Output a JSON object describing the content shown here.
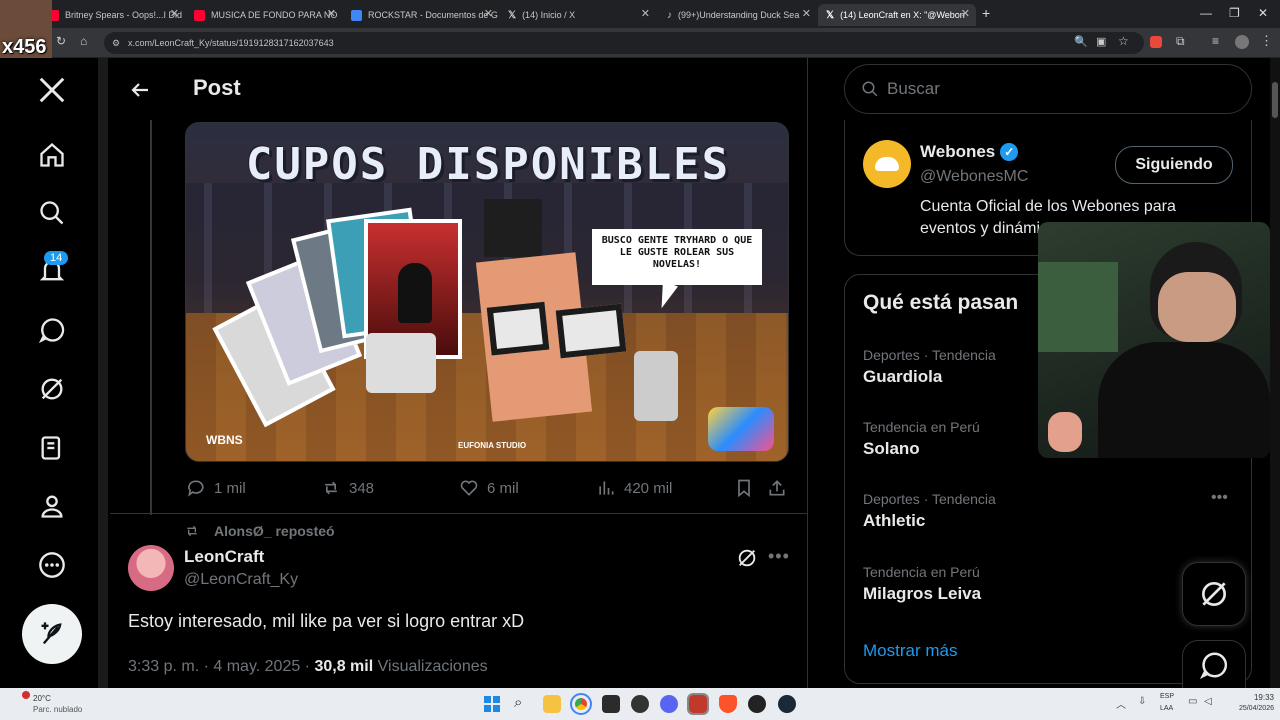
{
  "browser": {
    "tabs": [
      {
        "label": "Britney Spears - Oops!...I Did It",
        "color": "#ff0033"
      },
      {
        "label": "MUSICA DE FONDO PARA NO",
        "color": "#ff0033"
      },
      {
        "label": "ROCKSTAR - Documentos de G",
        "color": "#4285f4"
      },
      {
        "label": "(14) Inicio / X",
        "color": "#ffffff"
      },
      {
        "label": "(99+)Understanding Duck Sea",
        "color": "#ffffff"
      },
      {
        "label": "(14) LeonCraft en X: \"@Webon",
        "color": "#ffffff"
      }
    ],
    "new_tab": "+",
    "url": "x.com/LeonCraft_Ky/status/1919128317162037643",
    "overlay_badge": "x456"
  },
  "nav": {
    "notifications_count": "14"
  },
  "post": {
    "header_title": "Post",
    "image_caption": "CUPOS DISPONIBLES",
    "speech_bubble": "BUSCO GENTE TRYHARD O QUE LE GUSTE ROLEAR SUS NOVELAS!",
    "image_logos": [
      "WBNS",
      "EUFONIA STUDIO"
    ],
    "stats": {
      "replies": "1 mil",
      "reposts": "348",
      "likes": "6 mil",
      "views": "420 mil"
    },
    "reposted_by": "AlonsØ_ reposteó",
    "author_name": "LeonCraft",
    "author_handle": "@LeonCraft_Ky",
    "text": "Estoy interesado, mil like pa ver si logro entrar xD",
    "time": "3:33 p. m. · 4 may. 2025 ·",
    "views_count": "30,8 mil",
    "views_label": "Visualizaciones"
  },
  "right": {
    "search_placeholder": "Buscar",
    "profile": {
      "name": "Webones",
      "handle": "@WebonesMC",
      "bio": "Cuenta Oficial de los Webones para eventos y dinámi...",
      "button": "Siguiendo"
    },
    "trends_title": "Qué está pasan",
    "trends": [
      {
        "category": "Deportes · Tendencia",
        "name": "Guardiola"
      },
      {
        "category": "Tendencia en Perú",
        "name": "Solano"
      },
      {
        "category": "Deportes · Tendencia",
        "name": "Athletic"
      },
      {
        "category": "Tendencia en Perú",
        "name": "Milagros Leiva"
      }
    ],
    "show_more": "Mostrar más"
  },
  "taskbar": {
    "weather_temp": "20°C",
    "weather_desc": "Parc. nublado",
    "lang": "ESP",
    "lang2": "LAA",
    "time": "19:33",
    "date": "25/04/2026"
  }
}
